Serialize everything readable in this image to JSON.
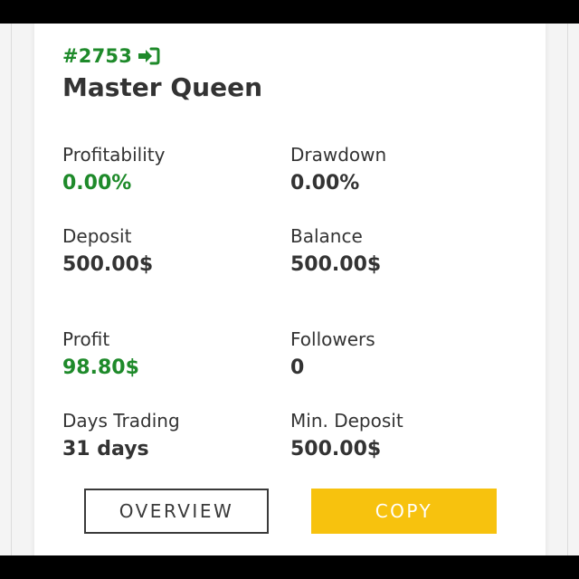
{
  "trader": {
    "id": "#2753",
    "name": "Master Queen",
    "login_icon": "login-arrow-icon"
  },
  "stats": {
    "profitability": {
      "label": "Profitability",
      "value": "0.00%"
    },
    "drawdown": {
      "label": "Drawdown",
      "value": "0.00%"
    },
    "deposit": {
      "label": "Deposit",
      "value": "500.00$"
    },
    "balance": {
      "label": "Balance",
      "value": "500.00$"
    },
    "profit": {
      "label": "Profit",
      "value": "98.80$"
    },
    "followers": {
      "label": "Followers",
      "value": "0"
    },
    "days_trading": {
      "label": "Days Trading",
      "value": "31 days"
    },
    "min_deposit": {
      "label": "Min. Deposit",
      "value": "500.00$"
    }
  },
  "actions": {
    "overview_label": "OVERVIEW",
    "copy_label": "COPY"
  },
  "colors": {
    "accent_green": "#1e8a2a",
    "copy_button": "#f7c20e",
    "text_dark": "#333333"
  }
}
